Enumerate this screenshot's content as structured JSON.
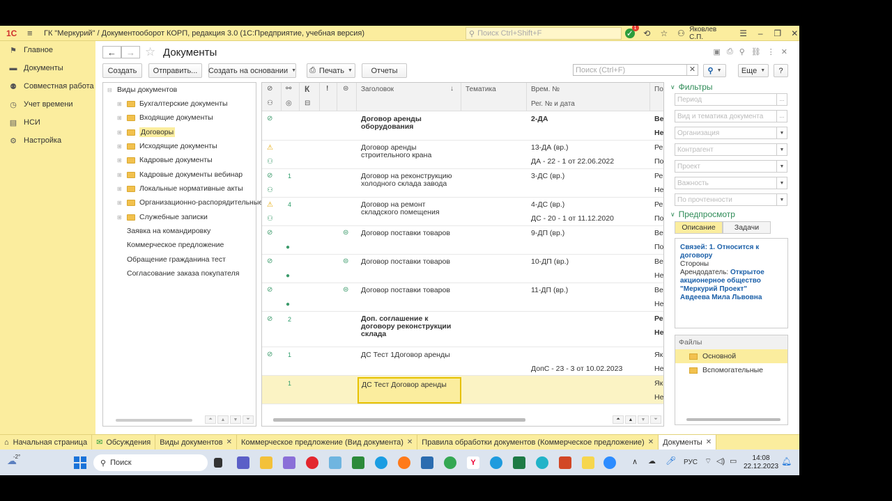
{
  "titlebar": {
    "app_logo": "1С",
    "title": "ГК \"Меркурий\" / Документооборот КОРП, редакция 3.0  (1С:Предприятие, учебная версия)",
    "search_placeholder": "Поиск Ctrl+Shift+F",
    "notif_count": "1",
    "user": "Яковлев С.П."
  },
  "sidebar": {
    "items": [
      {
        "label": "Главное",
        "icon": "flag-icon"
      },
      {
        "label": "Документы",
        "icon": "folder-icon"
      },
      {
        "label": "Совместная работа",
        "icon": "people-icon"
      },
      {
        "label": "Учет времени",
        "icon": "clock-icon"
      },
      {
        "label": "НСИ",
        "icon": "book-icon"
      },
      {
        "label": "Настройка",
        "icon": "gear-icon"
      }
    ]
  },
  "page": {
    "title": "Документы",
    "toolbar": {
      "create": "Создать",
      "send": "Отправить...",
      "create_based": "Создать на основании",
      "print": "Печать",
      "reports": "Отчеты",
      "search_placeholder": "Поиск (Ctrl+F)",
      "more": "Еще",
      "help": "?"
    }
  },
  "tree": {
    "root": "Виды документов",
    "folders": [
      "Бухгалтерские документы",
      "Входящие документы",
      "Договоры",
      "Исходящие документы",
      "Кадровые документы",
      "Кадровые документы вебинар",
      "Локальные нормативные акты",
      "Организационно-распорядительные",
      "Служебные записки"
    ],
    "items": [
      "Заявка на командировку",
      "Коммерческое предложение",
      "Обращение гражданина тест",
      "Согласование заказа покупателя"
    ]
  },
  "grid": {
    "headers": {
      "k": "К",
      "excl": "!",
      "title": "Заголовок",
      "sort": "↓",
      "topic": "Тематика",
      "tempnum": "Врем. №",
      "regdate": "Рег. № и дата",
      "trunc": "По"
    },
    "rows": [
      {
        "count": "",
        "title1": "Договор аренды",
        "title2": "оборудования",
        "title3": "",
        "bold": true,
        "num": "2-ДА",
        "reg": "",
        "last1": "Ве",
        "last2": "Не",
        "warn": false
      },
      {
        "count": "",
        "title1": "Договор аренды",
        "title2": "строительного крана",
        "title3": "",
        "bold": false,
        "num": "13-ДА (вр.)",
        "reg": "ДА - 22 - 1 от 22.06.2022",
        "last1": "Ре",
        "last2": "По",
        "warn": true
      },
      {
        "count": "1",
        "title1": "Договор на реконструкцию",
        "title2": "холодного склада завода",
        "title3": "",
        "bold": false,
        "num": "3-ДС (вр.)",
        "reg": "",
        "last1": "Ре",
        "last2": "Не",
        "warn": false
      },
      {
        "count": "4",
        "title1": "Договор на ремонт",
        "title2": "складского помещения",
        "title3": "",
        "bold": false,
        "num": "4-ДС (вр.)",
        "reg": "ДС - 20 - 1 от 11.12.2020",
        "last1": "Ре",
        "last2": "По",
        "warn": true
      },
      {
        "count": "",
        "title1": "Договор поставки товаров",
        "title2": "",
        "title3": "",
        "bold": false,
        "num": "9-ДП (вр.)",
        "reg": "",
        "last1": "Ве",
        "last2": "По",
        "warn": false
      },
      {
        "count": "",
        "title1": "Договор поставки товаров",
        "title2": "",
        "title3": "",
        "bold": false,
        "num": "10-ДП (вр.)",
        "reg": "",
        "last1": "Ве",
        "last2": "Не",
        "warn": false
      },
      {
        "count": "",
        "title1": "Договор поставки товаров",
        "title2": "",
        "title3": "",
        "bold": false,
        "num": "11-ДП (вр.)",
        "reg": "",
        "last1": "Ве",
        "last2": "Не",
        "warn": false
      },
      {
        "count": "2",
        "title1": "Доп. соглашение к",
        "title2": "договору реконструкции",
        "title3": "склада",
        "bold": true,
        "num": "",
        "reg": "",
        "last1": "Ре",
        "last2": "Не",
        "warn": false
      },
      {
        "count": "1",
        "title1": "ДС Тест 1Договор аренды",
        "title2": "",
        "title3": "",
        "bold": false,
        "num": "",
        "reg": "ДопС - 23 - 3 от 10.02.2023",
        "last1": "Як",
        "last2": "Не",
        "warn": false
      },
      {
        "count": "1",
        "title1": "ДС Тест Договор аренды",
        "title2": "",
        "title3": "",
        "bold": false,
        "num": "",
        "reg": "",
        "last1": "Як",
        "last2": "Не",
        "warn": false
      }
    ]
  },
  "filters": {
    "title": "Фильтры",
    "fields": [
      "Период",
      "Вид и тематика документа",
      "Организация",
      "Контрагент",
      "Проект",
      "Важность",
      "По прочтенности"
    ]
  },
  "preview": {
    "title": "Предпросмотр",
    "tab_desc": "Описание",
    "tab_tasks": "Задачи",
    "links": "Связей: 1. Относится к договору",
    "parties": "Стороны",
    "lessor_label": "Арендодатель:",
    "lessor": "Открытое акционерное общество \"Меркурий Проект\"",
    "person": "Авдеева Мила Львовна"
  },
  "files": {
    "title": "Файлы",
    "items": [
      "Основной",
      "Вспомогательные"
    ]
  },
  "bottom_tabs": [
    {
      "label": "Начальная страница",
      "closable": false
    },
    {
      "label": "Обсуждения",
      "closable": false
    },
    {
      "label": "Виды документов",
      "closable": true
    },
    {
      "label": "Коммерческое предложение (Вид документа)",
      "closable": true
    },
    {
      "label": "Правила обработки документов (Коммерческое предложение)",
      "closable": true
    },
    {
      "label": "Документы",
      "closable": true
    }
  ],
  "taskbar": {
    "weather": "-2°",
    "search": "Поиск",
    "lang": "РУС",
    "time": "14:08",
    "date": "22.12.2023"
  },
  "colors": {
    "accent_yellow": "#fbed9e",
    "green": "#2e8b57",
    "link": "#1a5fa8"
  }
}
